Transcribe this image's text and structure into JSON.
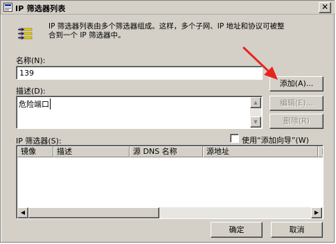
{
  "window": {
    "title": "IP 筛选器列表",
    "close_glyph": "✕"
  },
  "description": {
    "line1": "IP 筛选器列表由多个筛选器组成。这样，多个子网、IP 地址和协议可被整",
    "line2": "合到一个 IP 筛选器中。"
  },
  "name": {
    "label": "名称(N):",
    "value": "139"
  },
  "desc_field": {
    "label": "描述(D):",
    "value": "危险端口"
  },
  "buttons": {
    "add": "添加(A)...",
    "edit": "编辑(E)...",
    "delete": "删除(R)",
    "ok": "确定",
    "cancel": "取消"
  },
  "filters": {
    "label": "IP 筛选器(S):",
    "wizard_label": "使用“添加向导”(W)",
    "wizard_checked": false,
    "columns": [
      "镜像",
      "描述",
      "源 DNS 名称",
      "源地址",
      "目"
    ],
    "rows": []
  },
  "colors": {
    "face": "#d4d0c8",
    "annotation_arrow": "#e8231e"
  },
  "icons": [
    "app-icon",
    "filter-list-icon",
    "close-icon",
    "scroll-up-icon",
    "scroll-down-icon",
    "scroll-left-icon",
    "scroll-right-icon",
    "red-arrow-annotation"
  ]
}
